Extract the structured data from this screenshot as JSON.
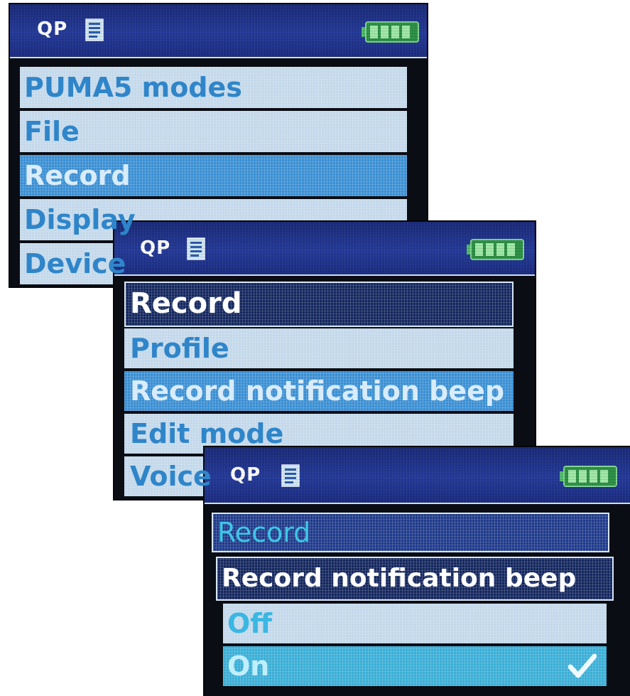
{
  "screens": [
    {
      "status": {
        "title": "QP",
        "doc_icon": "document-icon",
        "battery_icon": "battery-full-icon"
      },
      "items": [
        "PUMA5 modes",
        "File",
        "Record",
        "Display",
        "Device"
      ],
      "selected_index": 2
    },
    {
      "status": {
        "title": "QP",
        "doc_icon": "document-icon",
        "battery_icon": "battery-full-icon"
      },
      "header": "Record",
      "items": [
        "Profile",
        "Record notification beep",
        "Edit mode",
        "Voice"
      ],
      "selected_index": 1
    },
    {
      "status": {
        "title": "QP",
        "doc_icon": "document-icon",
        "battery_icon": "battery-full-icon"
      },
      "breadcrumb": "Record",
      "header": "Record notification beep",
      "options": [
        "Off",
        "On"
      ],
      "selected_option": "On",
      "checked_option": "On",
      "check_icon": "checkmark-icon"
    }
  ],
  "colors": {
    "statusbar": "#243a98",
    "item_bg": "#c3d8ea",
    "item_text": "#2f85c9",
    "selected_bg": "#3a8fd3",
    "header_bg": "#14275e",
    "option_selected_bg": "#3aaed6"
  }
}
